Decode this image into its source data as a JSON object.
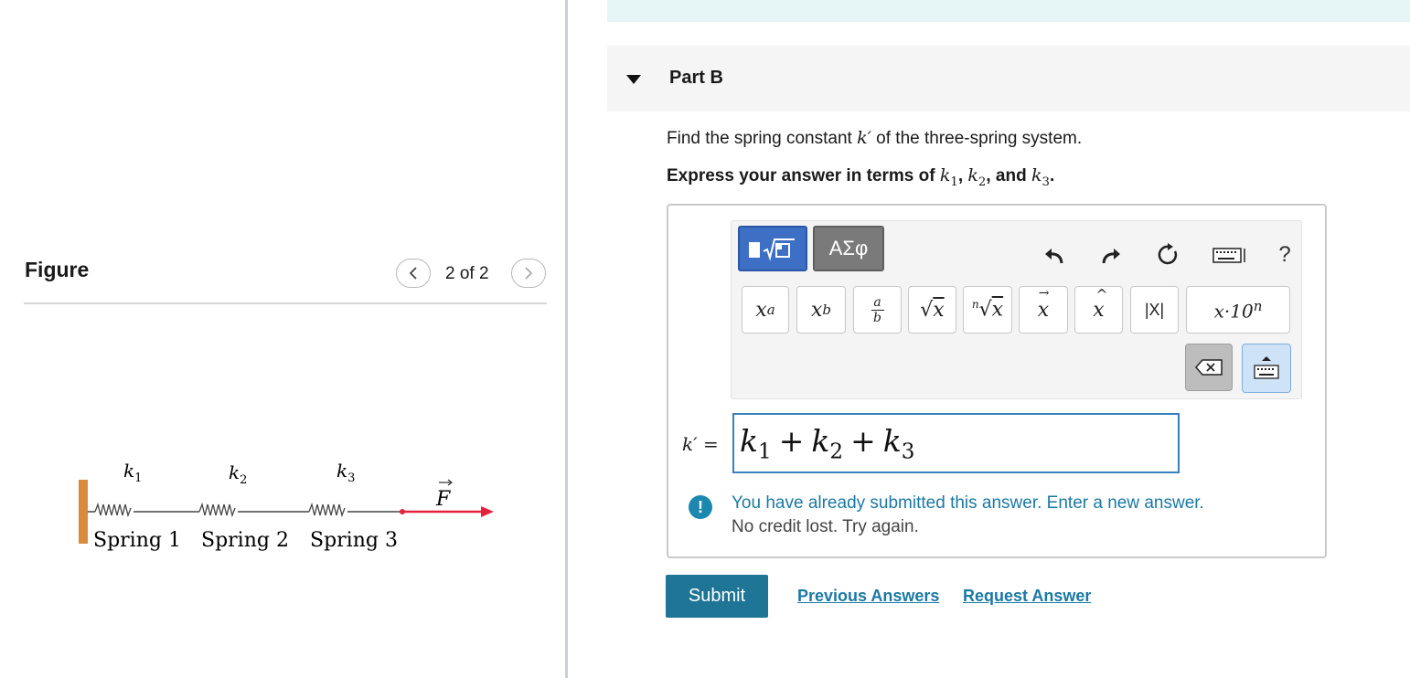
{
  "figure": {
    "title": "Figure",
    "counter": "2 of 2",
    "spring_labels": [
      "Spring 1",
      "Spring 2",
      "Spring 3"
    ],
    "constants": [
      {
        "base": "k",
        "sub": "1"
      },
      {
        "base": "k",
        "sub": "2"
      },
      {
        "base": "k",
        "sub": "3"
      }
    ],
    "force_label": "F",
    "colors": {
      "wall": "#d98a3a",
      "force": "#e5223d",
      "spring": "#444444"
    }
  },
  "part": {
    "title": "Part B",
    "question_before": "Find the spring constant ",
    "question_var": "k′",
    "question_after": " of the three-spring system.",
    "instruction_before": "Express your answer in terms of ",
    "instruction_vars": [
      "k1",
      "k2",
      "k3"
    ],
    "instruction_sep1": ", ",
    "instruction_sep2": ", and ",
    "instruction_after": "."
  },
  "toolbar": {
    "template_icon": "template-sqrt-icon",
    "greek_label": "ΑΣφ",
    "tool_icons": [
      "undo-icon",
      "redo-icon",
      "reset-icon",
      "keyboard-icon",
      "help-icon"
    ],
    "help_label": "?",
    "keys": [
      {
        "name": "superscript-key",
        "label": "x^a"
      },
      {
        "name": "subscript-key",
        "label": "x_b"
      },
      {
        "name": "fraction-key",
        "label": "a/b"
      },
      {
        "name": "sqrt-key",
        "label": "√x"
      },
      {
        "name": "nth-root-key",
        "label": "ⁿ√x"
      },
      {
        "name": "vector-key",
        "label": "x⃗"
      },
      {
        "name": "unit-vector-key",
        "label": "x̂"
      },
      {
        "name": "abs-key",
        "label": "|X|"
      },
      {
        "name": "sci-notation-key",
        "label": "x·10ⁿ"
      }
    ]
  },
  "answer": {
    "label": "k′ =",
    "value_terms": [
      "k1",
      "k2",
      "k3"
    ],
    "operator": "+"
  },
  "feedback": {
    "message": "You have already submitted this answer. Enter a new answer.",
    "sub": "No credit lost. Try again.",
    "icon": "!"
  },
  "actions": {
    "submit": "Submit",
    "previous": "Previous Answers",
    "request": "Request Answer"
  }
}
